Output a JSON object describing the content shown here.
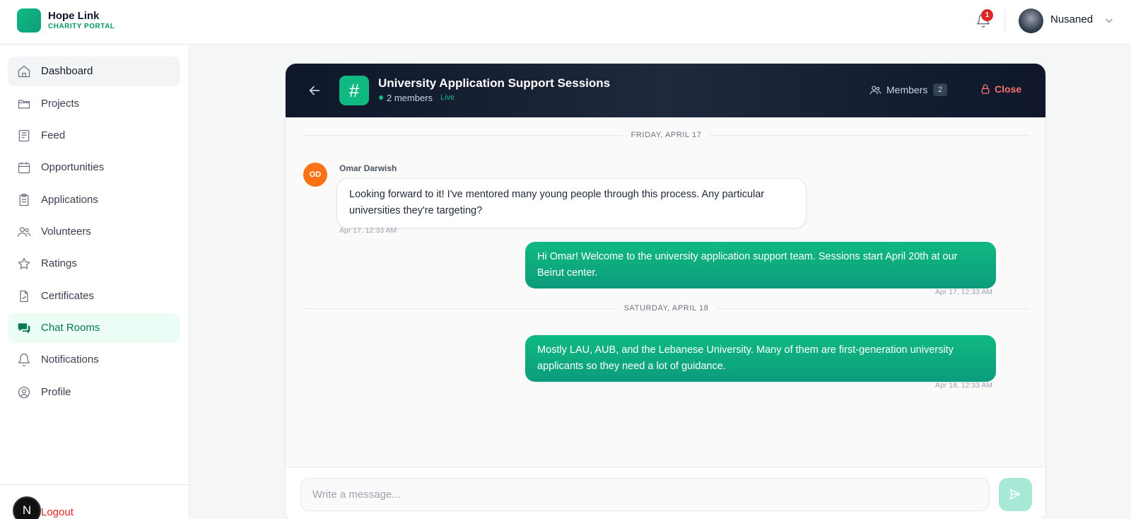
{
  "brand": {
    "name": "Hope Link",
    "subtitle": "CHARITY PORTAL"
  },
  "header": {
    "notification_count": "1",
    "user_name": "Nusaned",
    "icons": [
      "bell-icon",
      "chevron-down-icon"
    ]
  },
  "sidebar": {
    "items": [
      {
        "label": "Dashboard",
        "icon": "home-icon"
      },
      {
        "label": "Projects",
        "icon": "folder-icon"
      },
      {
        "label": "Feed",
        "icon": "newspaper-icon"
      },
      {
        "label": "Opportunities",
        "icon": "calendar-icon"
      },
      {
        "label": "Applications",
        "icon": "clipboard-icon"
      },
      {
        "label": "Volunteers",
        "icon": "users-icon"
      },
      {
        "label": "Ratings",
        "icon": "star-icon"
      },
      {
        "label": "Certificates",
        "icon": "file-check-icon"
      },
      {
        "label": "Chat Rooms",
        "icon": "chat-icon"
      },
      {
        "label": "Notifications",
        "icon": "bell-icon"
      },
      {
        "label": "Profile",
        "icon": "user-circle-icon"
      }
    ],
    "logout_avatar": "N",
    "logout_label": "Logout"
  },
  "chat": {
    "room_icon": "#",
    "title": "University Application Support Sessions",
    "members_text": "2 members",
    "live_label": "Live",
    "members_button": "Members",
    "members_count": "2",
    "close_label": "Close",
    "date_1": "FRIDAY, APRIL 17",
    "date_2": "SATURDAY, APRIL 18",
    "messages": [
      {
        "sender": "Omar Darwish",
        "initials": "OD",
        "text": "Looking forward to it! I've mentored many young people through this process. Any particular universities they're targeting?",
        "time": "Apr 17, 12:33 AM"
      },
      {
        "text": "Hi Omar! Welcome to the university application support team. Sessions start April 20th at our Beirut center.",
        "time": "Apr 17, 12:33 AM"
      },
      {
        "text": "Mostly LAU, AUB, and the Lebanese University. Many of them are first-generation university applicants so they need a lot of guidance.",
        "time": "Apr 18, 12:33 AM"
      }
    ],
    "input_placeholder": "Write a message..."
  },
  "colors": {
    "accent": "#10b981",
    "dark_header": "#0f172a",
    "danger": "#dc2626",
    "avatar_orange": "#f97316"
  }
}
